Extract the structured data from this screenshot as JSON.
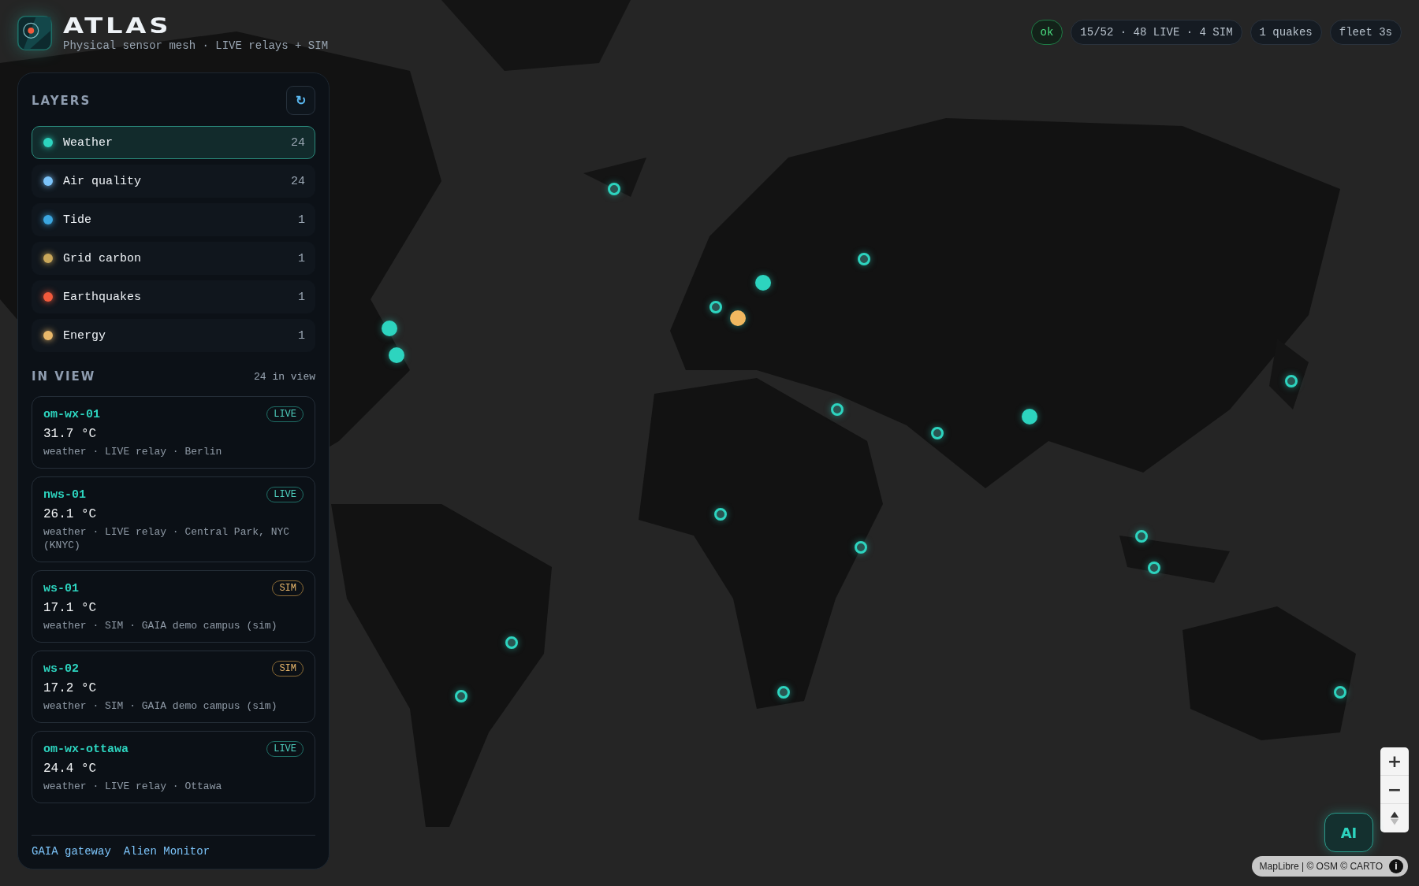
{
  "app": {
    "title": "ATLAS",
    "subtitle": "Physical sensor mesh · LIVE relays + SIM"
  },
  "status_pills": [
    {
      "label": "ok",
      "kind": "ok"
    },
    {
      "label": "15/52 · 48 LIVE · 4 SIM",
      "kind": "info"
    },
    {
      "label": "1 quakes",
      "kind": "info"
    },
    {
      "label": "fleet 3s",
      "kind": "info"
    }
  ],
  "layers": {
    "title": "LAYERS",
    "refresh_glyph": "↻",
    "items": [
      {
        "label": "Weather",
        "count": "24",
        "color": "#2dd4bf",
        "selected": true
      },
      {
        "label": "Air quality",
        "count": "24",
        "color": "#7cc4fa",
        "selected": false
      },
      {
        "label": "Tide",
        "count": "1",
        "color": "#3ba6e0",
        "selected": false
      },
      {
        "label": "Grid carbon",
        "count": "1",
        "color": "#c9a75a",
        "selected": false
      },
      {
        "label": "Earthquakes",
        "count": "1",
        "color": "#f25a3c",
        "selected": false
      },
      {
        "label": "Energy",
        "count": "1",
        "color": "#e9b86a",
        "selected": false
      }
    ]
  },
  "in_view": {
    "title": "IN VIEW",
    "count": "24 in view",
    "cards": [
      {
        "id": "om-wx-01",
        "reading": "31.7 °C",
        "meta": "weather · LIVE relay · Berlin",
        "badge": {
          "label": "LIVE",
          "kind": "live"
        }
      },
      {
        "id": "nws-01",
        "reading": "26.1 °C",
        "meta": "weather · LIVE relay · Central Park, NYC (KNYC)",
        "badge": {
          "label": "LIVE",
          "kind": "live"
        }
      },
      {
        "id": "ws-01",
        "reading": "17.1 °C",
        "meta": "weather · SIM · GAIA demo campus (sim)",
        "badge": {
          "label": "SIM",
          "kind": "sim"
        }
      },
      {
        "id": "ws-02",
        "reading": "17.2 °C",
        "meta": "weather · SIM · GAIA demo campus (sim)",
        "badge": {
          "label": "SIM",
          "kind": "sim"
        }
      },
      {
        "id": "om-wx-ottawa",
        "reading": "24.4 °C",
        "meta": "weather · LIVE relay · Ottawa",
        "badge": {
          "label": "LIVE",
          "kind": "live"
        }
      }
    ]
  },
  "footer_links": [
    "GAIA gateway",
    "Alien Monitor"
  ],
  "map": {
    "markers": [
      {
        "kind": "ring",
        "color": "#2dd4bf"
      },
      {
        "kind": "ring",
        "color": "#2dd4bf"
      },
      {
        "kind": "filled",
        "color": "#2dd4bf"
      },
      {
        "kind": "ring",
        "color": "#2dd4bf"
      },
      {
        "kind": "filled",
        "color": "#f0b860"
      },
      {
        "kind": "filled",
        "color": "#2dd4bf"
      },
      {
        "kind": "filled",
        "color": "#2dd4bf"
      },
      {
        "kind": "ring",
        "color": "#2dd4bf"
      },
      {
        "kind": "ring",
        "color": "#2dd4bf"
      },
      {
        "kind": "filled",
        "color": "#2dd4bf"
      },
      {
        "kind": "ring",
        "color": "#2dd4bf"
      },
      {
        "kind": "ring",
        "color": "#2dd4bf"
      },
      {
        "kind": "ring",
        "color": "#2dd4bf"
      },
      {
        "kind": "ring",
        "color": "#2dd4bf"
      },
      {
        "kind": "ring",
        "color": "#2dd4bf"
      },
      {
        "kind": "ring",
        "color": "#2dd4bf"
      },
      {
        "kind": "ring",
        "color": "#2dd4bf"
      },
      {
        "kind": "ring",
        "color": "#2dd4bf"
      },
      {
        "kind": "ring",
        "color": "#2dd4bf"
      }
    ],
    "zoom_in": "+",
    "zoom_out": "−",
    "attribution": "MapLibre | © OSM © CARTO",
    "info_glyph": "i"
  },
  "ai_button": "AI"
}
